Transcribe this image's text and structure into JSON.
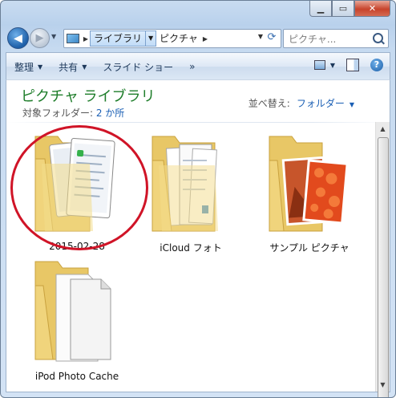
{
  "window": {
    "caption_buttons": {
      "minimize": "▁",
      "maximize": "▭",
      "close": "✕"
    }
  },
  "address_bar": {
    "crumbs": [
      "ライブラリ",
      "ピクチャ"
    ],
    "separator": "▶",
    "dropdown": "▼",
    "refresh": "⟳",
    "selected_crumb_index": 0
  },
  "search": {
    "placeholder": "ピクチャ..."
  },
  "command_bar": {
    "items": [
      "整理",
      "共有",
      "スライド ショー",
      "»"
    ],
    "dropdown_marker": "▼"
  },
  "library": {
    "title": "ピクチャ ライブラリ",
    "sub_prefix": "対象フォルダー: ",
    "sub_link": "2 か所",
    "arrange_label": "並べ替え:",
    "arrange_value": "フォルダー"
  },
  "items": [
    {
      "label": "2015-02-28",
      "type": "folder-phone-screenshots",
      "highlighted": true
    },
    {
      "label": "iCloud フォト",
      "type": "folder-documents"
    },
    {
      "label": "サンプル ピクチャ",
      "type": "folder-photos"
    },
    {
      "label": "iPod Photo Cache",
      "type": "folder-empty-pages"
    }
  ],
  "colors": {
    "library_title": "#1e7d2a",
    "link": "#1a5fb4",
    "highlight": "#d01427"
  }
}
